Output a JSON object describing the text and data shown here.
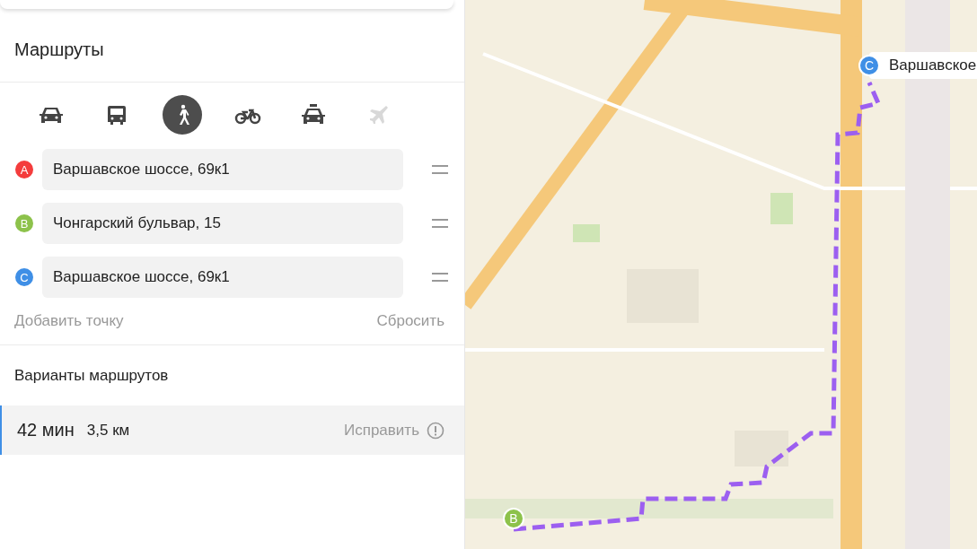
{
  "panel": {
    "title": "Маршруты",
    "modes": [
      {
        "kind": "car",
        "selected": false,
        "disabled": false
      },
      {
        "kind": "bus",
        "selected": false,
        "disabled": false
      },
      {
        "kind": "walk",
        "selected": true,
        "disabled": false
      },
      {
        "kind": "bike",
        "selected": false,
        "disabled": false
      },
      {
        "kind": "taxi",
        "selected": false,
        "disabled": false
      },
      {
        "kind": "plane",
        "selected": false,
        "disabled": true
      }
    ],
    "waypoints": [
      {
        "badge": "A",
        "color": "#f43c3c",
        "value": "Варшавское шоссе, 69к1"
      },
      {
        "badge": "B",
        "color": "#8dc24b",
        "value": "Чонгарский бульвар, 15"
      },
      {
        "badge": "C",
        "color": "#3f8fe6",
        "value": "Варшавское шоссе, 69к1"
      }
    ],
    "add_point": "Добавить точку",
    "reset": "Сбросить",
    "variants_title": "Варианты маршрутов",
    "routes": [
      {
        "duration": "42 мин",
        "distance": "3,5 км",
        "fix": "Исправить",
        "selected": true
      }
    ]
  },
  "map": {
    "kind": "picture",
    "markers": [
      {
        "badge": "B",
        "color": "#8dc24b"
      },
      {
        "badge": "C",
        "color": "#3f8fe6",
        "label": "Варшавское"
      }
    ]
  }
}
